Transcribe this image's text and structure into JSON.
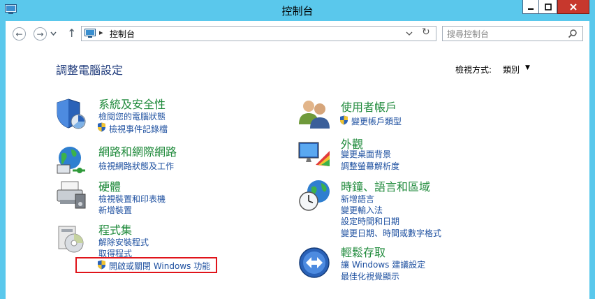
{
  "window": {
    "title": "控制台"
  },
  "address": {
    "breadcrumb": "控制台"
  },
  "search": {
    "placeholder": "搜尋控制台"
  },
  "page": {
    "heading": "調整電腦設定",
    "view_by_label": "檢視方式:",
    "view_by_value": "類別"
  },
  "categories": {
    "system": {
      "title": "系統及安全性",
      "links": [
        "檢閱您的電腦狀態",
        "檢視事件記錄檔"
      ]
    },
    "network": {
      "title": "網路和網際網路",
      "links": [
        "檢視網路狀態及工作"
      ]
    },
    "hardware": {
      "title": "硬體",
      "links": [
        "檢視裝置和印表機",
        "新增裝置"
      ]
    },
    "programs": {
      "title": "程式集",
      "links": [
        "解除安裝程式",
        "取得程式",
        "開啟或關閉 Windows 功能"
      ]
    },
    "users": {
      "title": "使用者帳戶",
      "links": [
        "變更帳戶類型"
      ]
    },
    "appearance": {
      "title": "外觀",
      "links": [
        "變更桌面背景",
        "調整螢幕解析度"
      ]
    },
    "clock": {
      "title": "時鐘、語言和區域",
      "links": [
        "新增語言",
        "變更輸入法",
        "設定時間和日期",
        "變更日期、時間或數字格式"
      ]
    },
    "ease": {
      "title": "輕鬆存取",
      "links": [
        "讓 Windows 建議設定",
        "最佳化視覺顯示"
      ]
    }
  },
  "colors": {
    "titlebar": "#5ac8ec",
    "category_title": "#1f8a3b",
    "link": "#1e50a0",
    "highlight": "#e0141a"
  }
}
